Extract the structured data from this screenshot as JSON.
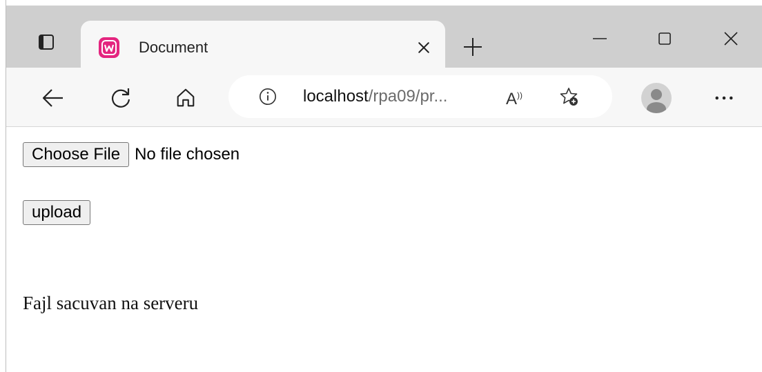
{
  "tab": {
    "title": "Document"
  },
  "address_bar": {
    "host": "localhost",
    "path": "/rpa09/pr...",
    "read_aloud": "A"
  },
  "page": {
    "choose_file_label": "Choose File",
    "file_status": "No file chosen",
    "upload_label": "upload",
    "message": "Fajl sacuvan na serveru"
  },
  "icons": {
    "tab_actions": "tab-actions-icon",
    "favicon": "wampserver-favicon-icon",
    "close": "close-icon",
    "new_tab": "plus-icon",
    "back": "arrow-left-icon",
    "refresh": "refresh-icon",
    "home": "home-icon",
    "info": "info-icon",
    "favorites": "add-favorite-icon",
    "profile": "profile-avatar-icon",
    "more": "more-dots-icon"
  },
  "colors": {
    "favicon_bg": "#e4257f",
    "titlebar": "#cfcfcf",
    "toolbar": "#f7f7f7"
  }
}
